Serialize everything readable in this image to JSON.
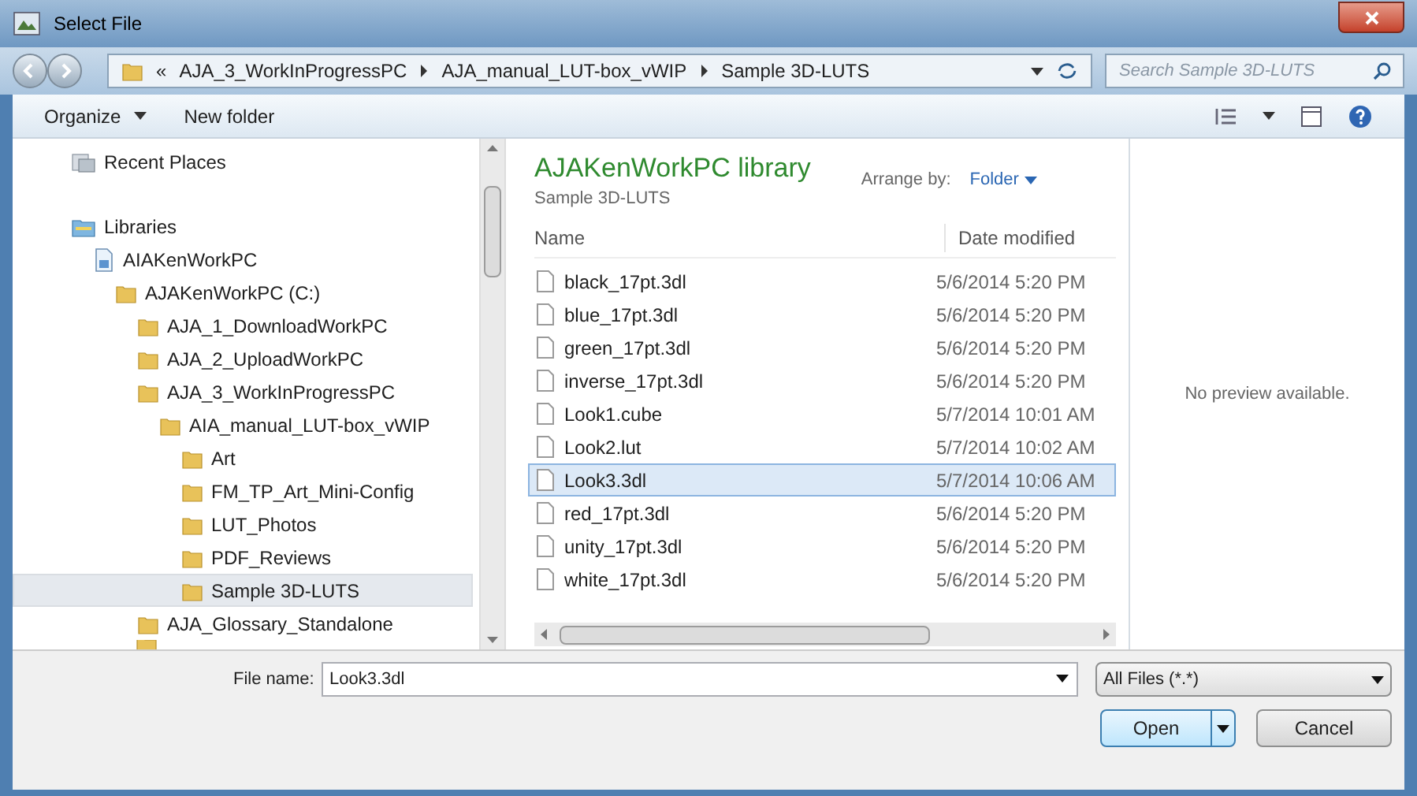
{
  "window": {
    "title": "Select File"
  },
  "address_bar": {
    "overflow": "«",
    "path": [
      "AJA_3_WorkInProgressPC",
      "AJA_manual_LUT-box_vWIP",
      "Sample 3D-LUTS"
    ]
  },
  "search": {
    "placeholder": "Search Sample 3D-LUTS"
  },
  "toolbar": {
    "buttons": [
      "Organize",
      "New folder"
    ]
  },
  "navigation": [
    {
      "label": "Recent Places",
      "kind": "recent",
      "selected": false
    },
    {
      "label": "Libraries",
      "kind": "library",
      "selected": false,
      "children": [
        {
          "label": "AIAKenWorkPC",
          "kind": "computer",
          "selected": false,
          "children": [
            {
              "label": "AJAKenWorkPC (C:)",
              "kind": "folder",
              "selected": false,
              "children": [
                {
                  "label": "AJA_1_DownloadWorkPC",
                  "kind": "folder",
                  "selected": false
                },
                {
                  "label": "AJA_2_UploadWorkPC",
                  "kind": "folder",
                  "selected": false
                },
                {
                  "label": "AJA_3_WorkInProgressPC",
                  "kind": "folder",
                  "selected": false,
                  "children": [
                    {
                      "label": "AIA_manual_LUT-box_vWIP",
                      "kind": "folder",
                      "selected": false,
                      "children": [
                        {
                          "label": "Art",
                          "kind": "folder",
                          "selected": false
                        },
                        {
                          "label": "FM_TP_Art_Mini-Config",
                          "kind": "folder",
                          "selected": false
                        },
                        {
                          "label": "LUT_Photos",
                          "kind": "folder",
                          "selected": false
                        },
                        {
                          "label": "PDF_Reviews",
                          "kind": "folder",
                          "selected": false
                        },
                        {
                          "label": "Sample 3D-LUTS",
                          "kind": "folder",
                          "selected": true
                        }
                      ]
                    }
                  ]
                },
                {
                  "label": "AJA_Glossary_Standalone",
                  "kind": "folder",
                  "selected": false
                }
              ]
            }
          ]
        }
      ]
    }
  ],
  "library": {
    "title": "AJAKenWorkPC library",
    "subtitle": "Sample 3D-LUTS",
    "arrange_label": "Arrange by:",
    "arrange_value": "Folder"
  },
  "table": {
    "columns": [
      "Name",
      "Date modified"
    ],
    "rows": [
      {
        "name": "black_17pt.3dl",
        "date": "5/6/2014 5:20 PM",
        "selected": false
      },
      {
        "name": "blue_17pt.3dl",
        "date": "5/6/2014 5:20 PM",
        "selected": false
      },
      {
        "name": "green_17pt.3dl",
        "date": "5/6/2014 5:20 PM",
        "selected": false
      },
      {
        "name": "inverse_17pt.3dl",
        "date": "5/6/2014 5:20 PM",
        "selected": false
      },
      {
        "name": "Look1.cube",
        "date": "5/7/2014 10:01 AM",
        "selected": false
      },
      {
        "name": "Look2.lut",
        "date": "5/7/2014 10:02 AM",
        "selected": false
      },
      {
        "name": "Look3.3dl",
        "date": "5/7/2014 10:06 AM",
        "selected": true
      },
      {
        "name": "red_17pt.3dl",
        "date": "5/6/2014 5:20 PM",
        "selected": false
      },
      {
        "name": "unity_17pt.3dl",
        "date": "5/6/2014 5:20 PM",
        "selected": false
      },
      {
        "name": "white_17pt.3dl",
        "date": "5/6/2014 5:20 PM",
        "selected": false
      }
    ]
  },
  "preview": {
    "message": "No preview available."
  },
  "file_name": {
    "label": "File name:",
    "value": "Look3.3dl"
  },
  "file_type": {
    "value": "All Files (*.*)"
  },
  "buttons": [
    "Open",
    "Cancel"
  ]
}
